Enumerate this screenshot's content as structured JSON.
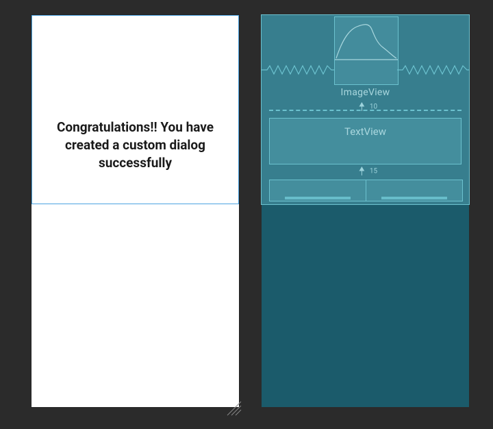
{
  "design": {
    "message": "Congratulations!! You have created a custom dialog successfully"
  },
  "blueprint": {
    "imageview_label": "ImageView",
    "textview_label": "TextView",
    "constraint_top": "10",
    "constraint_mid": "15"
  }
}
